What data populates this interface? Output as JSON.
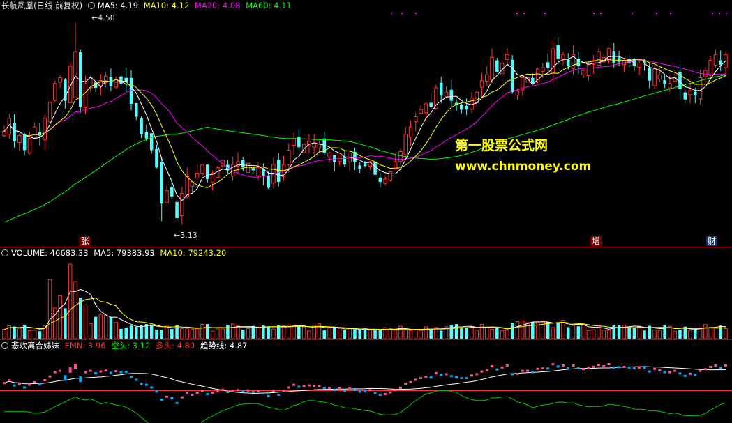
{
  "main": {
    "stock": "长航凤凰(日线 前复权)",
    "ma5": "MA5: 4.19",
    "ma10": "MA10: 4.12",
    "ma20": "MA20: 4.08",
    "ma60": "MA60: 4.11",
    "high_label": "4.50",
    "low_label": "3.13",
    "tag_zhang": "张",
    "tag_zeng": "增",
    "tag_cai": "财"
  },
  "volume": {
    "vol": "VOLUME: 46683.33",
    "ma5": "MA5: 79383.93",
    "ma10": "MA10: 79243.20"
  },
  "indicator": {
    "name": "悲欢离合姊妹",
    "emn": "EMN: 3.96",
    "kong": "空头: 3.12",
    "duo": "多头: 4.80",
    "trend": "趋势线: 4.87"
  },
  "watermark": {
    "line1": "第一股票公式网",
    "line2": "www.chnmoney.com"
  },
  "colors": {
    "up": "#ff3232",
    "down": "#54ffff",
    "ma5": "#ffffff",
    "ma10": "#ffff00",
    "ma20": "#ff00ff",
    "ma60": "#00ff00",
    "pink": "#ff4d9e"
  },
  "chart_data": {
    "type": "candlestick",
    "close": [
      3.75,
      3.84,
      3.68,
      3.72,
      3.62,
      3.7,
      3.78,
      3.72,
      3.84,
      3.95,
      4.08,
      4.12,
      3.96,
      4.2,
      4.3,
      3.92,
      4.08,
      4.12,
      4.05,
      4.1,
      4.13,
      4.06,
      4.11,
      4.08,
      4.09,
      3.94,
      3.85,
      3.73,
      3.7,
      3.62,
      3.5,
      3.25,
      3.34,
      3.3,
      3.15,
      3.32,
      3.44,
      3.4,
      3.46,
      3.52,
      3.42,
      3.46,
      3.5,
      3.55,
      3.48,
      3.52,
      3.54,
      3.5,
      3.53,
      3.48,
      3.5,
      3.44,
      3.36,
      3.52,
      3.4,
      3.52,
      3.62,
      3.7,
      3.64,
      3.66,
      3.68,
      3.67,
      3.66,
      3.6,
      3.6,
      3.54,
      3.6,
      3.52,
      3.6,
      3.54,
      3.49,
      3.51,
      3.54,
      3.45,
      3.4,
      3.42,
      3.47,
      3.54,
      3.61,
      3.73,
      3.78,
      3.85,
      3.9,
      3.94,
      3.92,
      4.05,
      4.0,
      4.02,
      3.96,
      3.93,
      3.9,
      3.9,
      3.98,
      4.02,
      4.1,
      4.14,
      4.26,
      4.16,
      4.22,
      4.28,
      4.02,
      4.03,
      4.12,
      4.12,
      4.08,
      4.18,
      4.19,
      4.19,
      4.32,
      4.25,
      4.28,
      4.2,
      4.28,
      4.2,
      4.17,
      4.21,
      4.24,
      4.3,
      4.26,
      4.32,
      4.22,
      4.23,
      4.24,
      4.22,
      4.2,
      4.22,
      4.22,
      4.1,
      4.18,
      4.14,
      4.08,
      4.08,
      4.12,
      4.04,
      3.97,
      4.03,
      4.0,
      4.12,
      4.17,
      4.24,
      4.28,
      4.21,
      4.28
    ],
    "volume_ma5": 79383.93,
    "price_high": 4.5,
    "price_low": 3.13
  }
}
